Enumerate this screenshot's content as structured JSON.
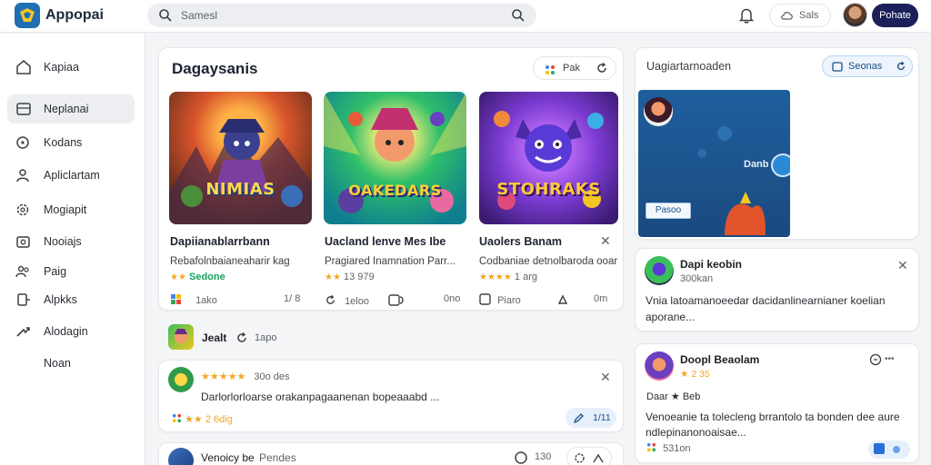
{
  "app": {
    "name": "Appopai"
  },
  "search": {
    "placeholder": "Samesl"
  },
  "topbar": {
    "pill_label": "Sals",
    "profile_label": "Pohate"
  },
  "sidebar": {
    "items": [
      {
        "label": "Kapiaa",
        "icon": "home-icon"
      },
      {
        "label": "Neplanai",
        "icon": "grid-icon",
        "active": true
      },
      {
        "label": "Kodans",
        "icon": "circle-icon"
      },
      {
        "label": "Apliclartam",
        "icon": "user-icon"
      },
      {
        "label": "Mogiapit",
        "icon": "settings-icon"
      },
      {
        "label": "Nooiajs",
        "icon": "camera-icon"
      },
      {
        "label": "Paig",
        "icon": "people-icon"
      },
      {
        "label": "Alpkks",
        "icon": "share-icon"
      },
      {
        "label": "Alodagin",
        "icon": "arrow-icon"
      },
      {
        "label": "Noan",
        "icon": ""
      }
    ]
  },
  "main": {
    "title": "Dagaysanis",
    "sort_label": "Pak",
    "games": [
      {
        "wordmark": "NIMIAS",
        "title": "Dapiianablarrbann",
        "sub": "Rebafolnbaianeaharir kag",
        "stars": "★★",
        "rating": "Sedone",
        "action": "1ako",
        "count": "1/ 8"
      },
      {
        "wordmark": "OAKEDARS",
        "title": "Uacland lenve Mes Ibe",
        "sub": "Pragiared Inamnation Parr...",
        "stars": "★★",
        "rating": "13 979",
        "action": "1eloo",
        "count": "0no"
      },
      {
        "wordmark": "STOHRAKS",
        "title": "Uaolers Banam",
        "sub": "Codbaniae detnolbaroda ooar",
        "stars": "★★★★",
        "rating": "1 arg",
        "action": "Piaro",
        "count": "0m"
      }
    ],
    "feed_label": "Jealt",
    "feed_meta": "1apo",
    "post": {
      "stars": "★★★★★",
      "time": "30o des",
      "text": "Darlorlorloarse orakanpagaanenan bopeaaabd ...",
      "stats": "★★ 2 6dig",
      "count": "1/11"
    },
    "bottom": {
      "title": "Venoicy be",
      "tag": "Pendes",
      "count": "130"
    }
  },
  "right": {
    "header": "Uagiartarnoaden",
    "search_label": "Seonas",
    "banner": {
      "label": "Danb",
      "button": "Pasoo"
    },
    "card1": {
      "title": "Dapi keobin",
      "meta": "300kan",
      "text": "Vnia latoamanoeedar dacidanlinearnianer koelian aporane..."
    },
    "card2": {
      "title": "Doopl Beaolam",
      "meta": "★ 2 35",
      "line": "Daar ★ Beb",
      "text": "Venoeanie ta tolecleng brrantolo ta bonden dee aure ndlepinanonoaisae...",
      "stats": "531on"
    }
  }
}
